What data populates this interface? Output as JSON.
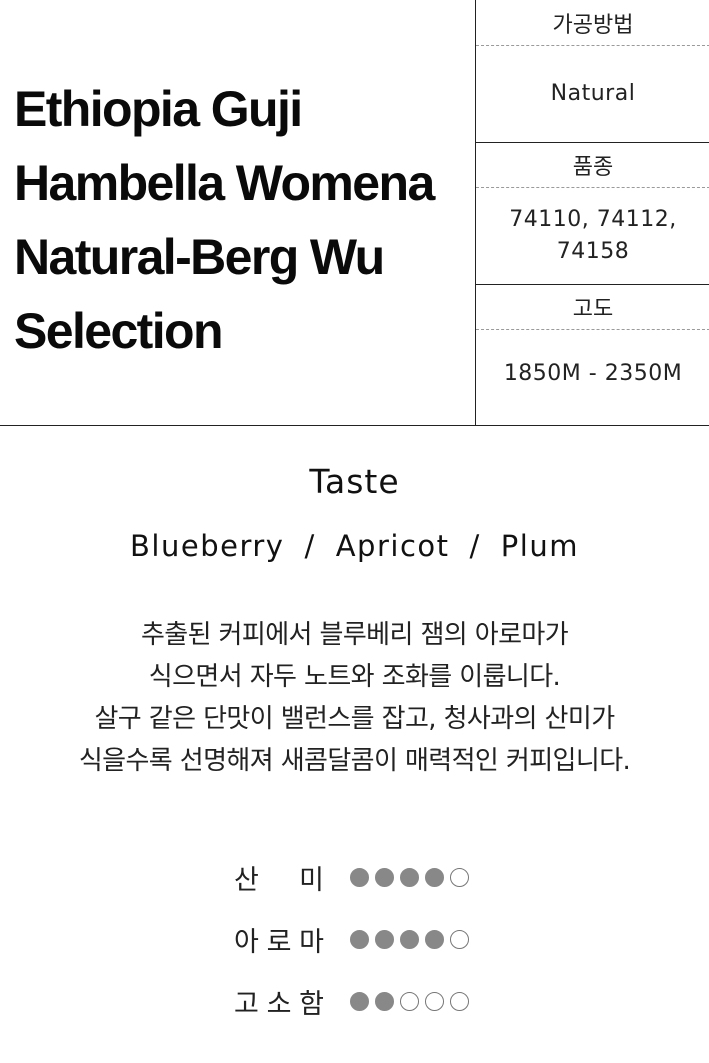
{
  "product": {
    "title_lines": [
      "Ethiopia Guji",
      "Hambella Womena",
      "Natural-Berg Wu",
      "Selection"
    ]
  },
  "specs": [
    {
      "label": "가공방법",
      "value": "Natural"
    },
    {
      "label": "품종",
      "value": "74110, 74112, 74158"
    },
    {
      "label": "고도",
      "value": "1850M - 2350M"
    }
  ],
  "taste": {
    "heading": "Taste",
    "notes": [
      "Blueberry",
      "Apricot",
      "Plum"
    ],
    "separator": "/"
  },
  "description": [
    "추출된 커피에서 블루베리 잼의 아로마가",
    "식으면서 자두 노트와 조화를 이룹니다.",
    "살구 같은 단맛이 밸런스를 잡고, 청사과의 산미가",
    "식을수록 선명해져 새콤달콤이 매력적인 커피입니다."
  ],
  "ratings": [
    {
      "label": "산미",
      "chars": [
        "산",
        "미"
      ],
      "score": 4,
      "max": 5
    },
    {
      "label": "아로마",
      "chars": [
        "아",
        "로",
        "마"
      ],
      "score": 4,
      "max": 5
    },
    {
      "label": "고소함",
      "chars": [
        "고",
        "소",
        "함"
      ],
      "score": 2,
      "max": 5
    }
  ],
  "colors": {
    "dot_filled": "#888888",
    "dot_empty_border": "#777777",
    "text": "#111111",
    "dashed_rule": "#9a9a9a"
  }
}
